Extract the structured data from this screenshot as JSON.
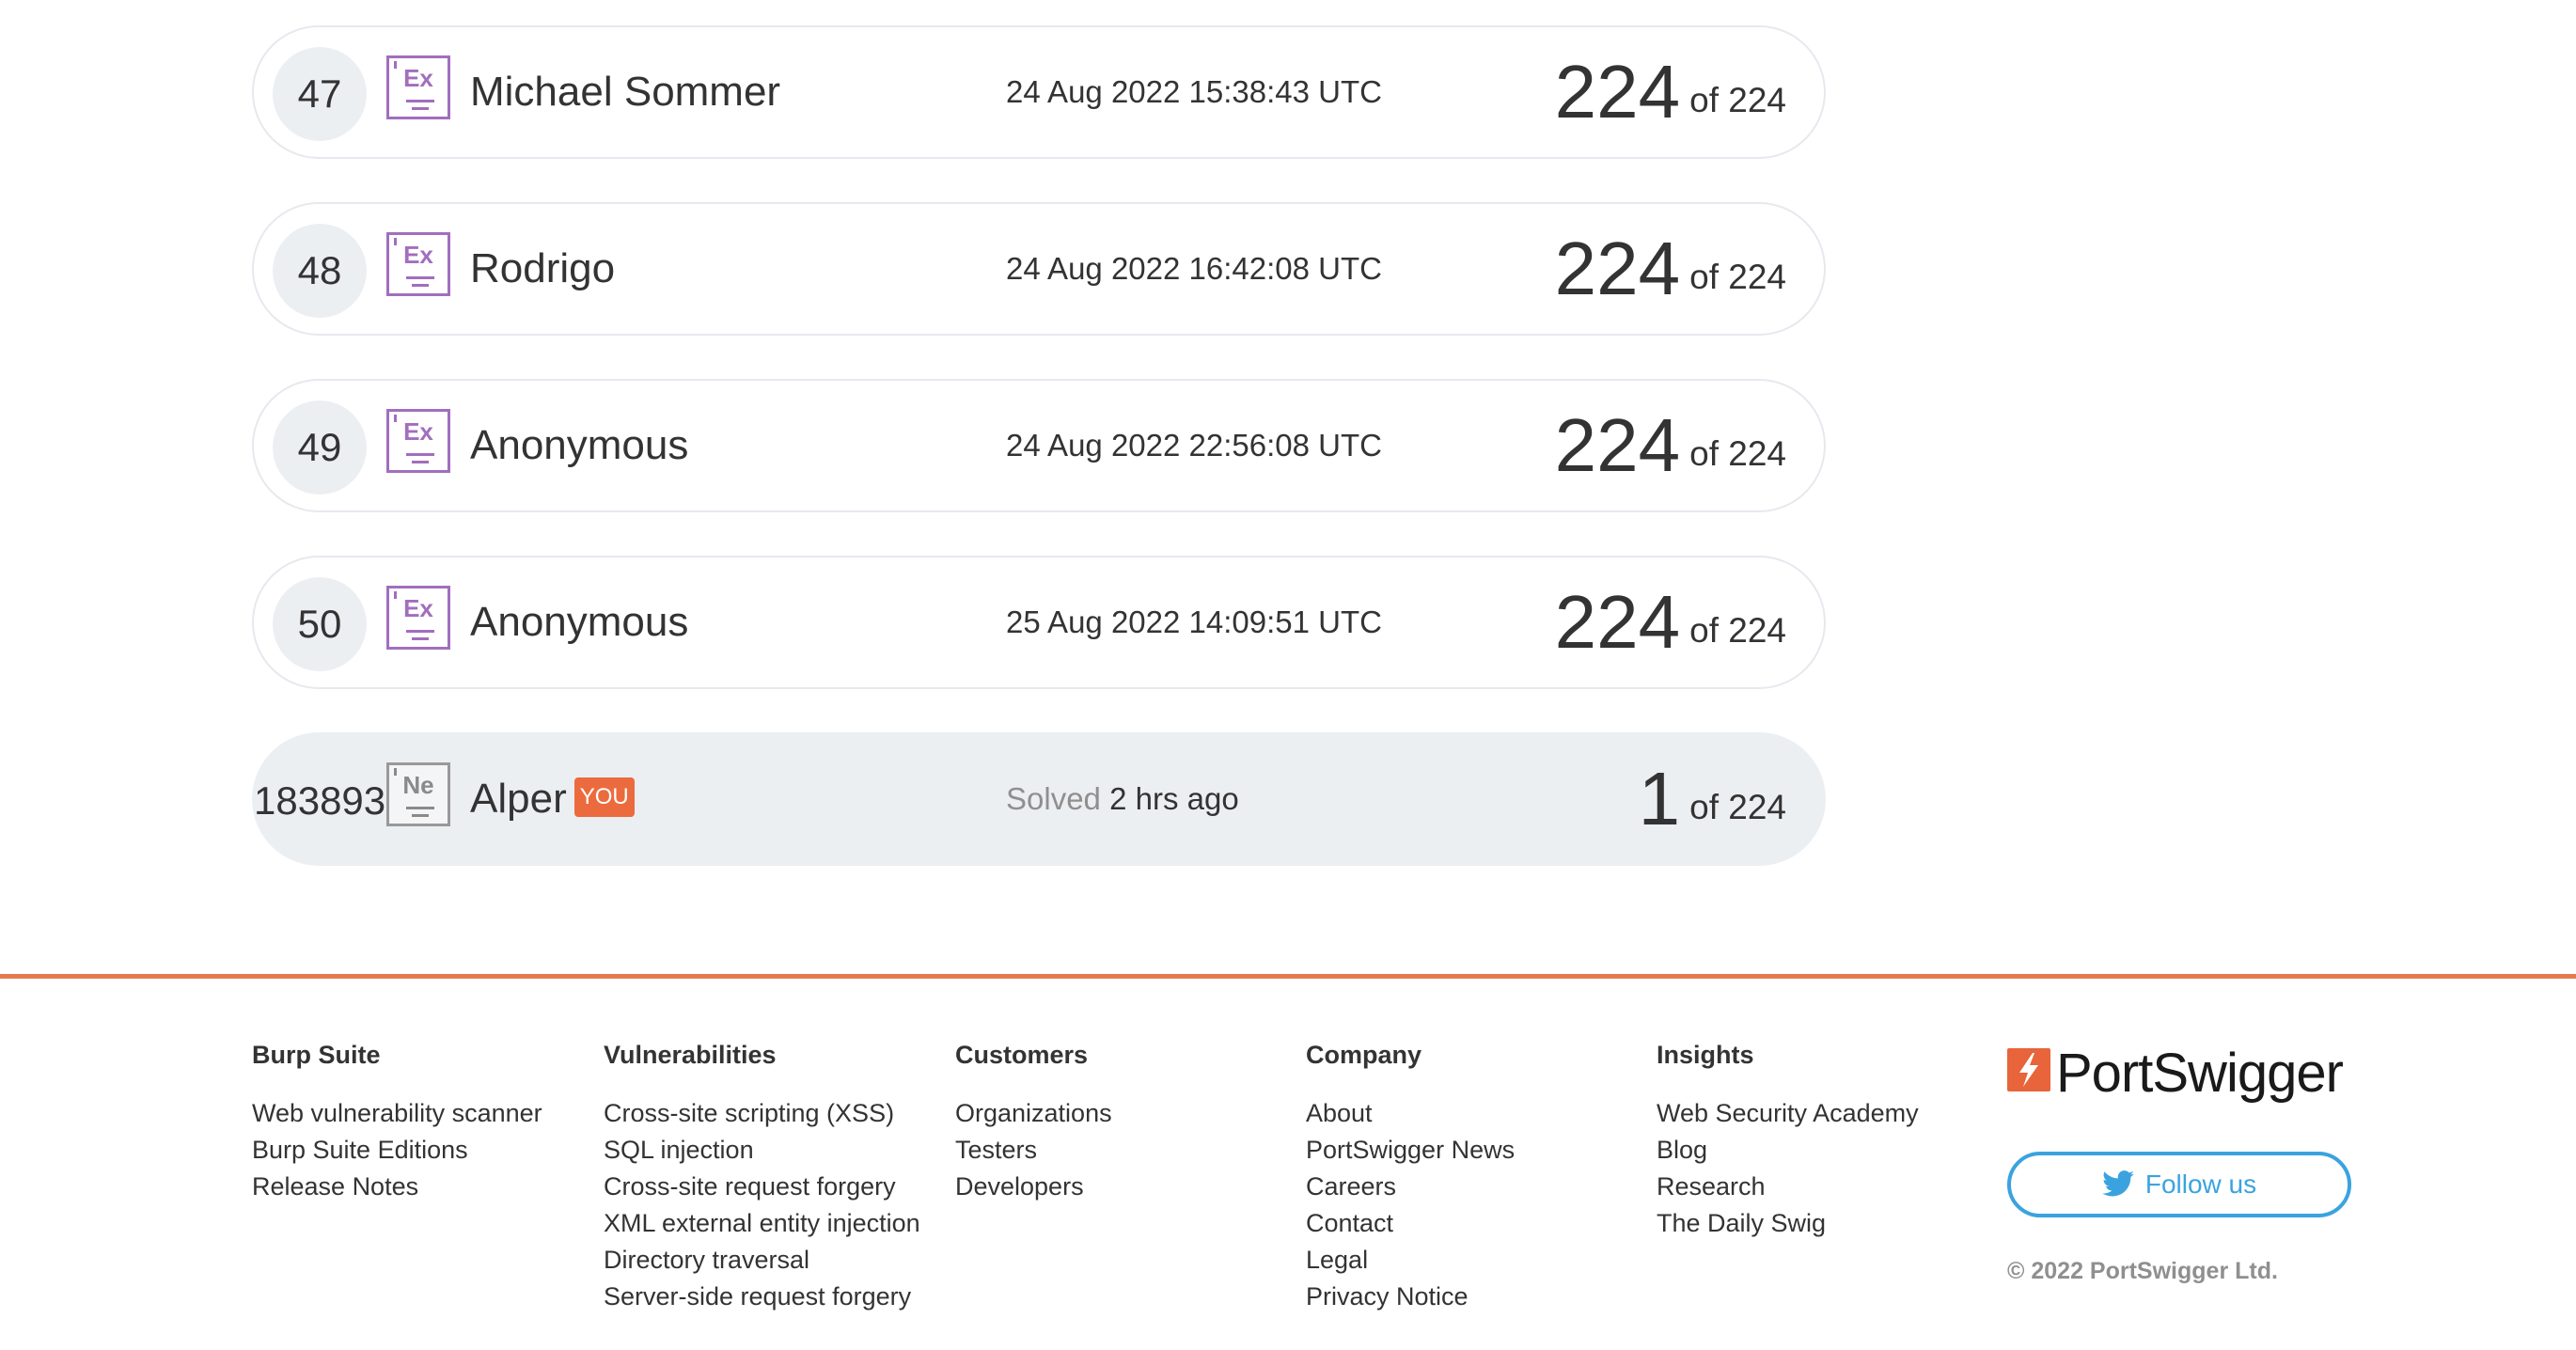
{
  "leaderboard": {
    "rows": [
      {
        "rank": "47",
        "level_symbol": "Ex",
        "name": "Michael Sommer",
        "date": "24 Aug 2022 15:38:43 UTC",
        "score": "224",
        "of_total": "of 224"
      },
      {
        "rank": "48",
        "level_symbol": "Ex",
        "name": "Rodrigo",
        "date": "24 Aug 2022 16:42:08 UTC",
        "score": "224",
        "of_total": "of 224"
      },
      {
        "rank": "49",
        "level_symbol": "Ex",
        "name": "Anonymous",
        "date": "24 Aug 2022 22:56:08 UTC",
        "score": "224",
        "of_total": "of 224"
      },
      {
        "rank": "50",
        "level_symbol": "Ex",
        "name": "Anonymous",
        "date": "25 Aug 2022 14:09:51 UTC",
        "score": "224",
        "of_total": "of 224"
      }
    ],
    "current_user": {
      "rank": "183893",
      "level_symbol": "Ne",
      "name": "Alper",
      "you_badge": "YOU",
      "solved_label": "Solved",
      "solved_ago": "2 hrs ago",
      "score": "1",
      "of_total": "of 224"
    }
  },
  "footer": {
    "columns": [
      {
        "title": "Burp Suite",
        "links": [
          "Web vulnerability scanner",
          "Burp Suite Editions",
          "Release Notes"
        ]
      },
      {
        "title": "Vulnerabilities",
        "links": [
          "Cross-site scripting (XSS)",
          "SQL injection",
          "Cross-site request forgery",
          "XML external entity injection",
          "Directory traversal",
          "Server-side request forgery"
        ]
      },
      {
        "title": "Customers",
        "links": [
          "Organizations",
          "Testers",
          "Developers"
        ]
      },
      {
        "title": "Company",
        "links": [
          "About",
          "PortSwigger News",
          "Careers",
          "Contact",
          "Legal",
          "Privacy Notice"
        ]
      },
      {
        "title": "Insights",
        "links": [
          "Web Security Academy",
          "Blog",
          "Research",
          "The Daily Swig"
        ]
      }
    ],
    "logo_text": "PortSwigger",
    "follow_label": "Follow us",
    "copyright": "© 2022 PortSwigger Ltd."
  },
  "colors": {
    "accent_orange": "#e47a4f",
    "expert_purple": "#a26ebd",
    "twitter_blue": "#3aa3df"
  },
  "icons": {
    "level_badge": "level-badge-icon",
    "logo": "portswigger-logo-icon",
    "twitter": "twitter-bird-icon"
  }
}
